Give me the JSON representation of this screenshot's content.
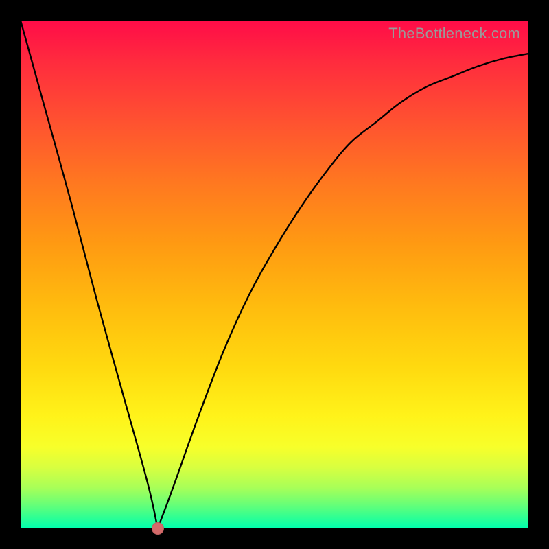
{
  "watermark": "TheBottleneck.com",
  "colors": {
    "frame": "#000000",
    "curve": "#000000",
    "marker": "#d46a6a"
  },
  "chart_data": {
    "type": "line",
    "title": "",
    "xlabel": "",
    "ylabel": "",
    "xlim": [
      0,
      100
    ],
    "ylim": [
      0,
      100
    ],
    "grid": false,
    "legend": false,
    "series": [
      {
        "name": "bottleneck-curve",
        "x": [
          0,
          5,
          10,
          15,
          20,
          25,
          27,
          30,
          35,
          40,
          45,
          50,
          55,
          60,
          65,
          70,
          75,
          80,
          85,
          90,
          95,
          100
        ],
        "values": [
          100,
          82,
          64,
          45,
          27,
          9,
          0,
          8,
          22,
          35,
          46,
          55,
          63,
          70,
          76,
          80,
          84,
          87,
          89,
          91,
          92.5,
          93.5
        ]
      }
    ],
    "marker": {
      "x": 27,
      "y": 0
    }
  }
}
